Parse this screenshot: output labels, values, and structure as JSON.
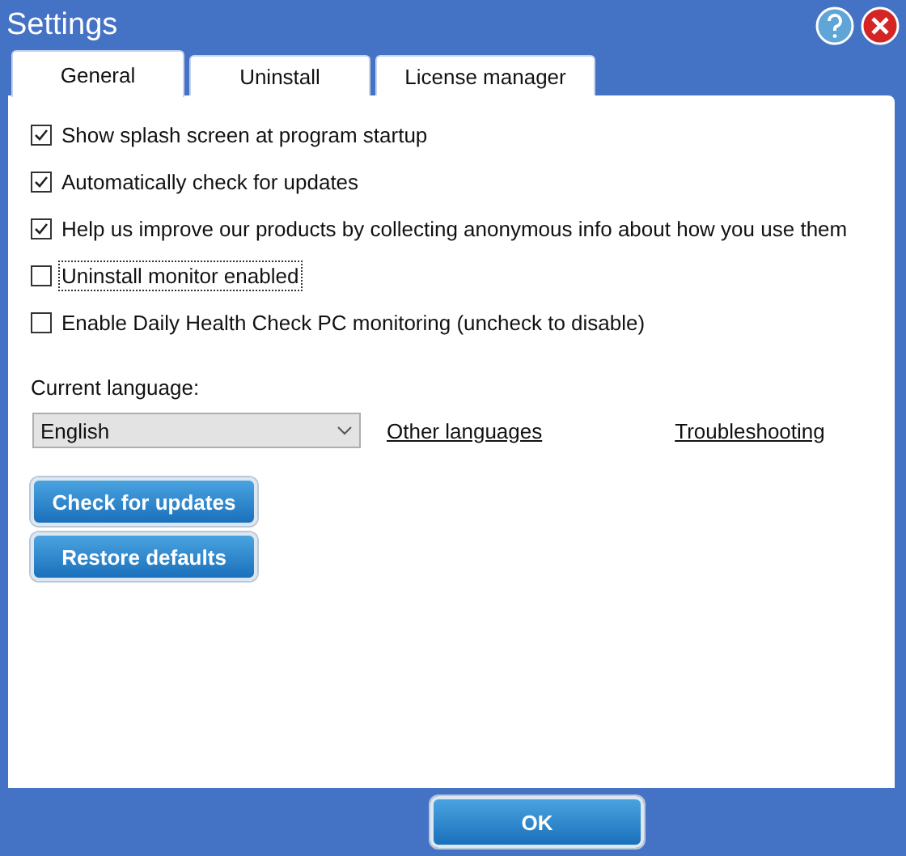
{
  "window": {
    "title": "Settings"
  },
  "tabs": [
    {
      "label": "General",
      "selected": true
    },
    {
      "label": "Uninstall",
      "selected": false
    },
    {
      "label": "License manager",
      "selected": false
    }
  ],
  "options": [
    {
      "label": "Show splash screen at program startup",
      "checked": true,
      "focused": false
    },
    {
      "label": "Automatically check for updates",
      "checked": true,
      "focused": false
    },
    {
      "label": "Help us improve our products by collecting anonymous info about how you use them",
      "checked": true,
      "focused": false
    },
    {
      "label": "Uninstall monitor enabled",
      "checked": false,
      "focused": true
    },
    {
      "label": "Enable Daily Health Check PC monitoring (uncheck to disable)",
      "checked": false,
      "focused": false
    }
  ],
  "language": {
    "label": "Current language:",
    "value": "English"
  },
  "links": [
    "Other languages",
    "Troubleshooting"
  ],
  "buttons": [
    "Check for updates",
    "Restore defaults"
  ],
  "footer_buttons": [
    "OK"
  ]
}
